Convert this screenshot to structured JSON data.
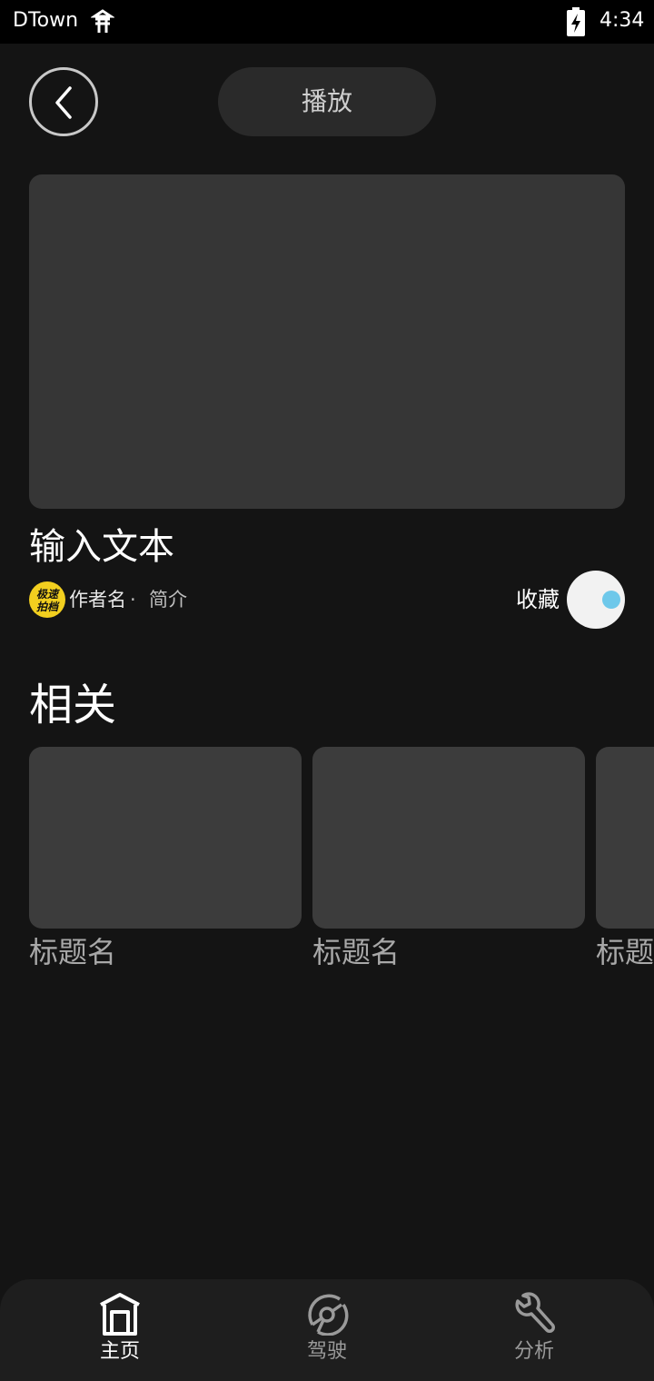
{
  "status_bar": {
    "carrier": "DTown",
    "time": "4:34"
  },
  "header": {
    "play_label": "播放"
  },
  "content": {
    "title": "输入文本",
    "author_avatar_text": "极速拍档",
    "author_name": "作者名",
    "separator": "·",
    "intro_label": "简介",
    "favorite_label": "收藏",
    "favorite_on": true
  },
  "related": {
    "section_title": "相关",
    "items": [
      {
        "title": "标题名"
      },
      {
        "title": "标题名"
      },
      {
        "title": "标题名"
      }
    ]
  },
  "bottom_nav": {
    "items": [
      {
        "label": "主页",
        "icon": "home-icon",
        "active": true
      },
      {
        "label": "驾驶",
        "icon": "steering-wheel-icon",
        "active": false
      },
      {
        "label": "分析",
        "icon": "wrench-icon",
        "active": false
      }
    ]
  },
  "colors": {
    "background": "#141414",
    "card": "#363636",
    "accent_toggle": "#6ec8ea",
    "avatar": "#f2cf1f"
  }
}
